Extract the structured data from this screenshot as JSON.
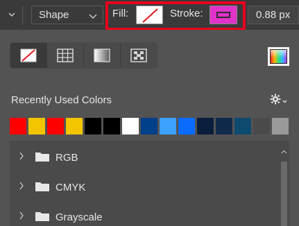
{
  "options_bar": {
    "mode_dropdown_label": "Shape",
    "fill_label": "Fill:",
    "stroke_label": "Stroke:",
    "stroke_width_value": "0.88 px",
    "fill_color": "#ffffff",
    "stroke_color": "#e232c9",
    "highlight_color": "#e8001c"
  },
  "panel": {
    "type_buttons": [
      {
        "name": "no-color",
        "icon": "no-fill-icon"
      },
      {
        "name": "solid-color",
        "icon": "solid-color-grid-icon"
      },
      {
        "name": "gradient",
        "icon": "gradient-icon"
      },
      {
        "name": "pattern",
        "icon": "pattern-icon"
      }
    ],
    "recent_colors_title": "Recently Used Colors",
    "recent_colors": [
      "#ff0000",
      "#f2c500",
      "#ff0000",
      "#f2c500",
      "#000000",
      "#000000",
      "#ffffff",
      "#003f8a",
      "#3da1ff",
      "#0a6cff",
      "#0a1d3d",
      "#102a4a",
      "#0d4a6e",
      "#4a4a4a",
      "#9a9a9a"
    ],
    "folders": [
      {
        "label": "RGB"
      },
      {
        "label": "CMYK"
      },
      {
        "label": "Grayscale"
      }
    ]
  }
}
